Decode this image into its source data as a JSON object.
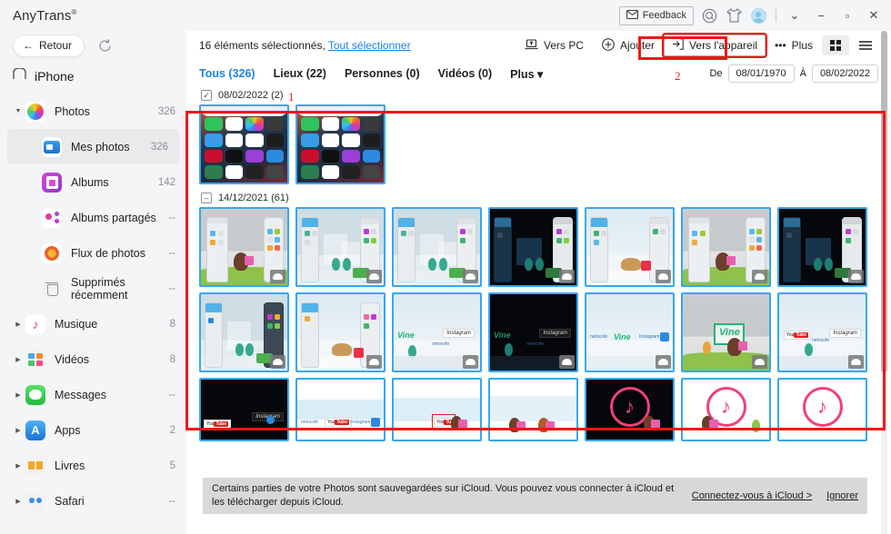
{
  "titlebar": {
    "app_name": "AnyTrans",
    "trademark": "®",
    "feedback_label": "Feedback",
    "icons": [
      "search-icon",
      "tshirt-icon",
      "avatar"
    ],
    "window_controls": [
      "chevron-down",
      "minimize",
      "maximize",
      "close"
    ]
  },
  "sidebar": {
    "back_label": "Retour",
    "refresh_icon": "refresh-icon",
    "device_name": "iPhone",
    "items": [
      {
        "label": "Photos",
        "count": "326",
        "icon": "photos-icon",
        "expandable": true,
        "expanded": true,
        "level": 0
      },
      {
        "label": "Mes photos",
        "count": "326",
        "icon": "my-photos-icon",
        "expandable": false,
        "selected": true,
        "level": 1
      },
      {
        "label": "Albums",
        "count": "142",
        "icon": "albums-icon",
        "expandable": false,
        "level": 1
      },
      {
        "label": "Albums partagés",
        "count": "--",
        "icon": "shared-albums-icon",
        "expandable": false,
        "level": 1
      },
      {
        "label": "Flux de photos",
        "count": "--",
        "icon": "photo-stream-icon",
        "expandable": false,
        "level": 1
      },
      {
        "label": "Supprimés récemment",
        "count": "--",
        "icon": "trash-icon",
        "expandable": false,
        "level": 1
      },
      {
        "label": "Musique",
        "count": "8",
        "icon": "music-icon",
        "expandable": true,
        "level": 0
      },
      {
        "label": "Vidéos",
        "count": "8",
        "icon": "videos-icon",
        "expandable": true,
        "level": 0
      },
      {
        "label": "Messages",
        "count": "--",
        "icon": "messages-icon",
        "expandable": false,
        "level": 0
      },
      {
        "label": "Apps",
        "count": "2",
        "icon": "apps-icon",
        "expandable": false,
        "level": 0
      },
      {
        "label": "Livres",
        "count": "5",
        "icon": "books-icon",
        "expandable": true,
        "level": 0
      },
      {
        "label": "Safari",
        "count": "--",
        "icon": "safari-icon",
        "expandable": true,
        "level": 0
      }
    ]
  },
  "toolbar": {
    "selection_text": "16 éléments sélectionnés,",
    "select_all_label": "Tout sélectionner",
    "to_pc_label": "Vers PC",
    "add_label": "Ajouter",
    "to_device_label": "Vers l'appareil",
    "more_label": "Plus",
    "grid_view_icon": "grid-view-icon",
    "list_view_icon": "list-view-icon"
  },
  "tabs": [
    {
      "label": "Tous (326)",
      "active": true
    },
    {
      "label": "Lieux (22)",
      "active": false
    },
    {
      "label": "Personnes (0)",
      "active": false
    },
    {
      "label": "Vidéos (0)",
      "active": false
    },
    {
      "label": "Plus ▾",
      "active": false
    }
  ],
  "date_filter": {
    "from_label": "De",
    "from_value": "08/01/1970",
    "to_label": "À",
    "to_value": "08/02/2022"
  },
  "groups": [
    {
      "checkbox": "checked",
      "check_glyph": "✓",
      "date": "08/02/2022 (2)",
      "count_photos": 2
    },
    {
      "checkbox": "indeterminate",
      "check_glyph": "–",
      "date": "14/12/2021 (61)",
      "count_photos": 61
    }
  ],
  "annotations": [
    {
      "number": "1",
      "color": "#f21616"
    },
    {
      "number": "2",
      "color": "#f21616"
    }
  ],
  "notification": {
    "text": "Certains parties de votre Photos sont sauvegardées sur iCloud. Vous pouvez vous connecter à iCloud et les télécharger depuis iCloud.",
    "link_label": "Connectez-vous à iCloud >",
    "ignore_label": "Ignorer"
  },
  "colors": {
    "accent": "#1b82e0",
    "selection_border": "#35a8f0",
    "annotation_red": "#f21616",
    "sidebar_bg": "#f4f5f7",
    "content_bg": "#ffffff"
  }
}
